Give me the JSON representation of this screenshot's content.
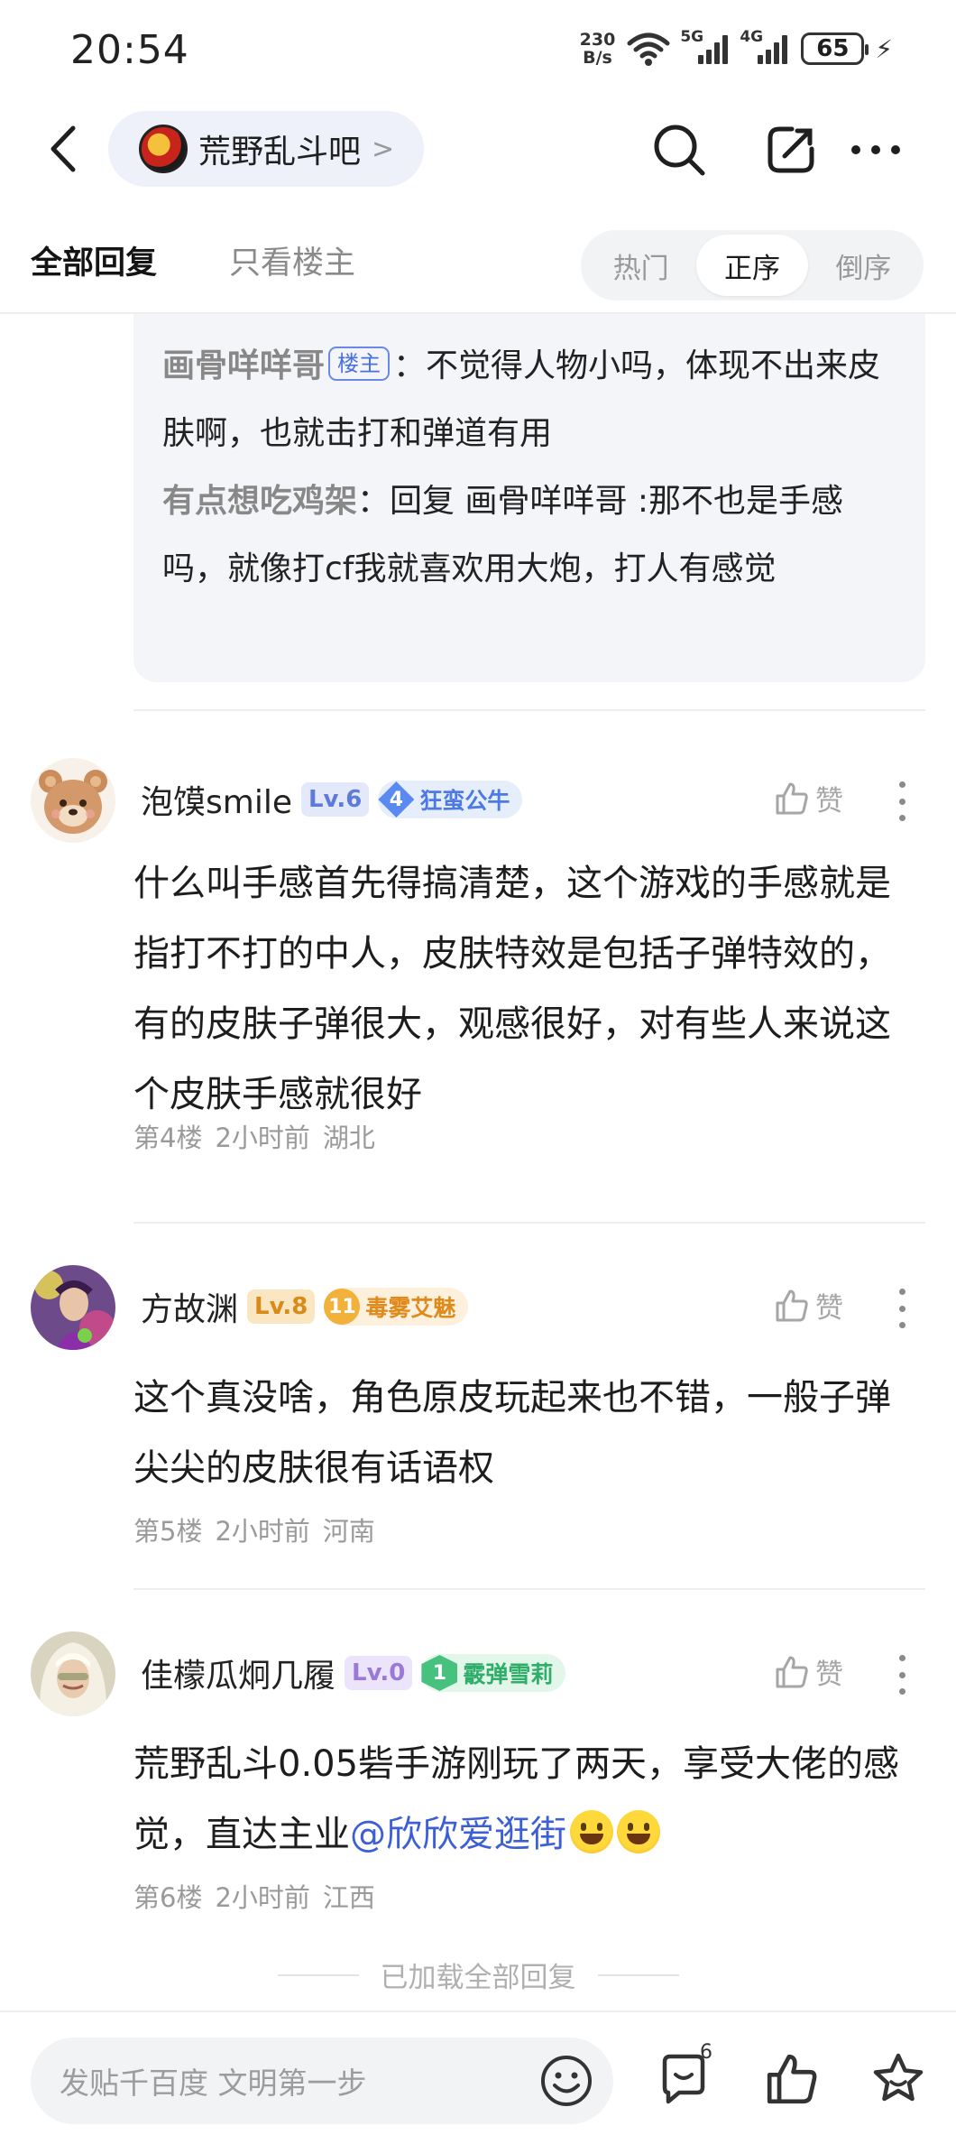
{
  "status_bar": {
    "time": "20:54",
    "net_speed_value": "230",
    "net_speed_unit": "B/s",
    "signal_1_label": "5G",
    "signal_2_label": "4G",
    "battery": "65"
  },
  "nav": {
    "forum_name": "荒野乱斗吧",
    "forum_arrow": ">"
  },
  "filter": {
    "all_replies": "全部回复",
    "op_only": "只看楼主",
    "sort_hot": "热门",
    "sort_asc": "正序",
    "sort_desc": "倒序",
    "active_sort": "正序"
  },
  "sub_replies": [
    {
      "user": "画骨咩咩哥",
      "badge": "楼主",
      "text": "：不觉得人物小吗，体现不出来皮肤啊，也就击打和弹道有用"
    },
    {
      "user": "有点想吃鸡架",
      "text": "：回复 画骨咩咩哥 :那不也是手感吗，就像打cf我就喜欢用大炮，打人有感觉"
    }
  ],
  "comments": [
    {
      "name": "泡馍smile",
      "level": "Lv.6",
      "title_num": "4",
      "title": "狂蛮公牛",
      "like_label": "赞",
      "body": "什么叫手感首先得搞清楚，这个游戏的手感就是指打不打的中人，皮肤特效是包括子弹特效的，有的皮肤子弹很大，观感很好，对有些人来说这个皮肤手感就很好",
      "floor": "第4楼",
      "time": "2小时前",
      "location": "湖北"
    },
    {
      "name": "方故渊",
      "level": "Lv.8",
      "title_num": "11",
      "title": "毒雾艾魅",
      "like_label": "赞",
      "body": "这个真没啥，角色原皮玩起来也不错，一般子弹尖尖的皮肤很有话语权",
      "floor": "第5楼",
      "time": "2小时前",
      "location": "河南"
    },
    {
      "name": "佳檬瓜炯几履",
      "level": "Lv.0",
      "title_num": "1",
      "title": "霰弹雪莉",
      "like_label": "赞",
      "body_prefix": "荒野乱斗0.05砦手游刚玩了两天，享受大佬的感觉，直达主业",
      "mention": "@欣欣爱逛街",
      "floor": "第6楼",
      "time": "2小时前",
      "location": "江西"
    }
  ],
  "footer": {
    "loaded_all": "已加载全部回复",
    "input_placeholder": "发贴千百度 文明第一步",
    "comment_count": "6"
  },
  "colors": {
    "accent_blue": "#4a6fe0",
    "mention": "#3d5fd6",
    "lv6": "#5e7bd9",
    "lv8": "#d98a18",
    "lv0": "#9b79d6"
  }
}
